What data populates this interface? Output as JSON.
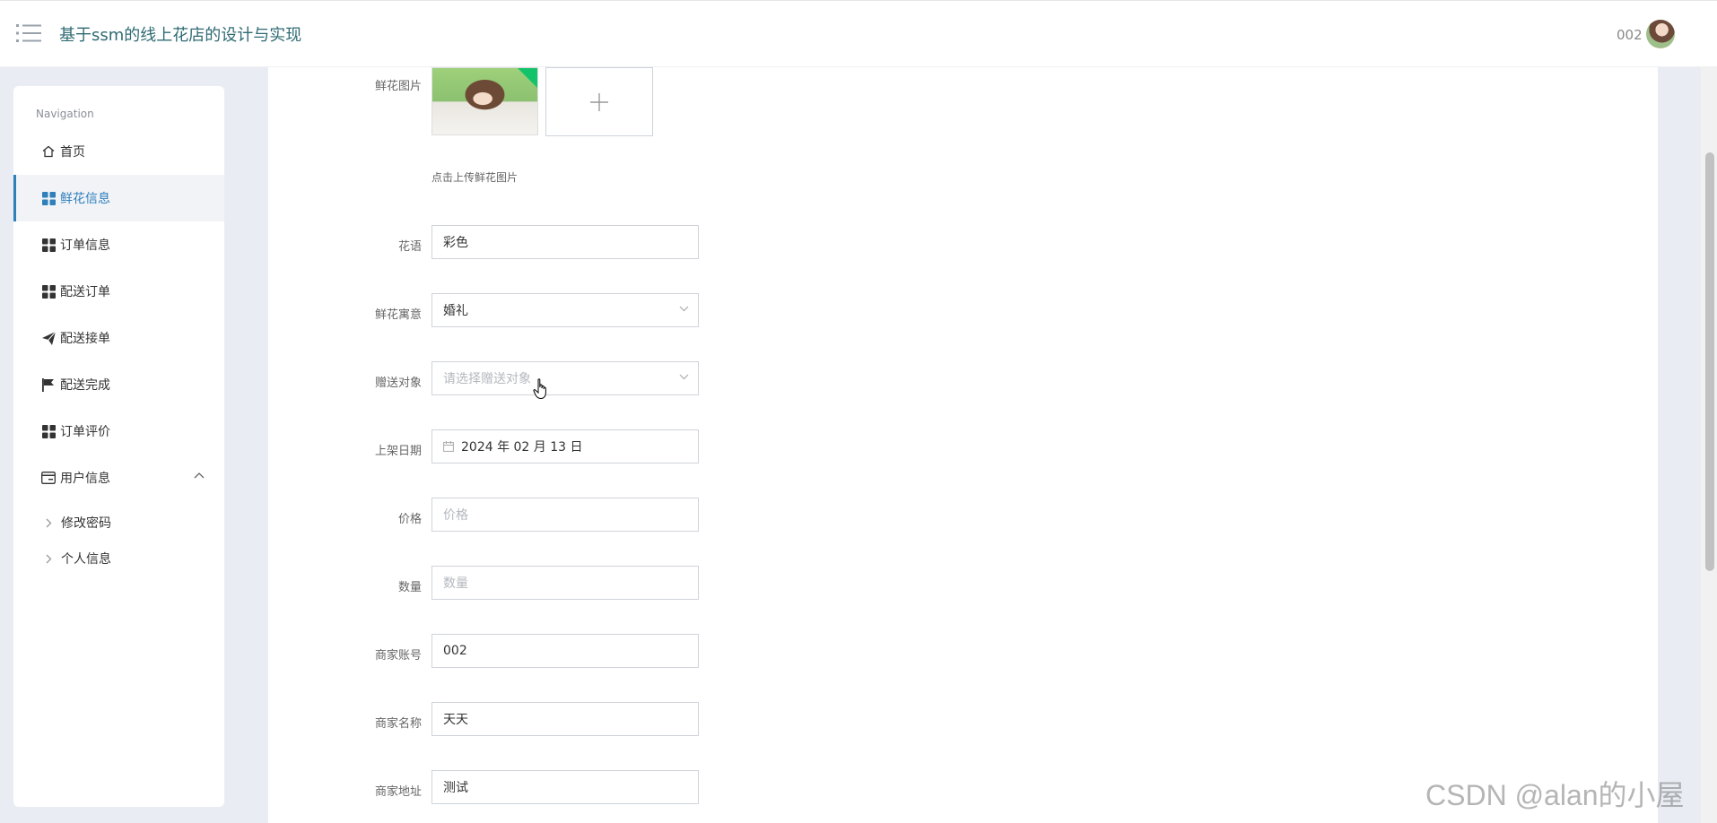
{
  "header": {
    "title": "基于ssm的线上花店的设计与实现",
    "user": "002"
  },
  "sidebar": {
    "heading": "Navigation",
    "items": [
      {
        "label": "首页",
        "icon": "home-icon"
      },
      {
        "label": "鲜花信息",
        "icon": "grid-icon",
        "active": true
      },
      {
        "label": "订单信息",
        "icon": "grid-icon"
      },
      {
        "label": "配送订单",
        "icon": "grid-icon"
      },
      {
        "label": "配送接单",
        "icon": "send-icon"
      },
      {
        "label": "配送完成",
        "icon": "flag-icon"
      },
      {
        "label": "订单评价",
        "icon": "grid-icon"
      },
      {
        "label": "用户信息",
        "icon": "card-icon",
        "expanded": true
      }
    ],
    "subitems": [
      {
        "label": "修改密码"
      },
      {
        "label": "个人信息"
      }
    ]
  },
  "form": {
    "image": {
      "label": "鲜花图片",
      "hint": "点击上传鲜花图片"
    },
    "flower_language": {
      "label": "花语",
      "value": "彩色"
    },
    "meaning": {
      "label": "鲜花寓意",
      "value": "婚礼"
    },
    "recipient": {
      "label": "赠送对象",
      "placeholder": "请选择赠送对象"
    },
    "listing_date": {
      "label": "上架日期",
      "value": "2024 年 02 月 13 日"
    },
    "price": {
      "label": "价格",
      "placeholder": "价格"
    },
    "quantity": {
      "label": "数量",
      "placeholder": "数量"
    },
    "merchant_account": {
      "label": "商家账号",
      "value": "002"
    },
    "merchant_name": {
      "label": "商家名称",
      "value": "天天"
    },
    "merchant_address": {
      "label": "商家地址",
      "value": "测试"
    }
  },
  "watermark": "CSDN @alan的小屋",
  "colors": {
    "accent": "#2f7fbb",
    "title": "#2f6b73",
    "background": "#e9edf3"
  }
}
